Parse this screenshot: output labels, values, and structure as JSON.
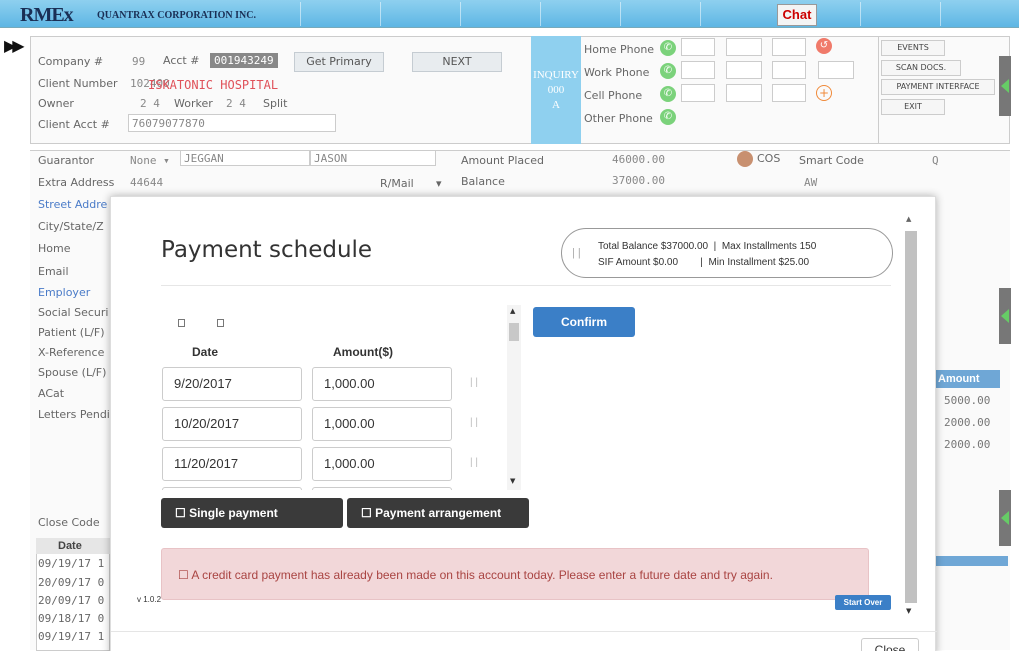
{
  "header": {
    "logo": "RMEx",
    "corporation": "QUANTRAX CORPORATION INC.",
    "chat_label": "Chat"
  },
  "account": {
    "company_label": "Company #",
    "company_value": "99",
    "acct_label": "Acct #",
    "acct_value": "001943249",
    "get_primary_label": "Get Primary",
    "next_label": "NEXT",
    "client_number_label": "Client Number",
    "client_number_value": "102400",
    "client_name": "ISKATONIC HOSPITAL",
    "owner_label": "Owner",
    "owner_value": "2 4",
    "worker_label": "Worker",
    "worker_value": "2 4",
    "split_label": "Split",
    "client_acct_label": "Client Acct #",
    "client_acct_value": "76079077870",
    "inquiry_lines": [
      "INQUIRY",
      "000",
      "A"
    ],
    "phones": [
      "Home Phone",
      "Work Phone",
      "Cell Phone",
      "Other Phone"
    ],
    "side_buttons": [
      "EVENTS",
      "SCAN DOCS.",
      "PAYMENT INTERFACE",
      "EXIT"
    ]
  },
  "form": {
    "guarantor_label": "Guarantor",
    "guarantor_select": "None",
    "guarantor_last": "JEGGAN",
    "guarantor_first": "JASON",
    "amount_placed_label": "Amount Placed",
    "amount_placed_value": "46000.00",
    "cos_label": "COS",
    "smart_code_label": "Smart Code",
    "smart_code_value": "Q",
    "extra_address_label": "Extra Address",
    "extra_address_value": "44644",
    "rmail_label": "R/Mail",
    "balance_label": "Balance",
    "balance_value": "37000.00",
    "aw_value": "AW",
    "street_label": "Street Addre",
    "city_label": "City/State/Z",
    "home_label": "Home",
    "email_label": "Email",
    "employer_label": "Employer",
    "social_label": "Social Securi",
    "patient_label": "Patient (L/F)",
    "xref_label": "X-Reference",
    "spouse_label": "Spouse (L/F)",
    "acat_label": "ACat",
    "letters_label": "Letters Pendi",
    "close_code_label": "Close Code",
    "date_header": "Date",
    "history_dates": [
      "09/19/17",
      "20/09/17",
      "20/09/17",
      "09/18/17",
      "09/19/17"
    ],
    "history_suffix": [
      "1",
      "0",
      "0",
      "0",
      "1"
    ],
    "right_amount_header": "Amount",
    "right_amounts": [
      "5000.00",
      "2000.00",
      "2000.00"
    ]
  },
  "modal": {
    "title": "Payment schedule",
    "total_balance": "Total Balance $37000.00",
    "max_installments": "Max Installments 150",
    "sif_amount": "SIF Amount  $0.00",
    "min_installment": "Min Installment  $25.00",
    "date_header": "Date",
    "amount_header": "Amount($)",
    "rows": [
      {
        "date": "9/20/2017",
        "amount": "1,000.00"
      },
      {
        "date": "10/20/2017",
        "amount": "1,000.00"
      },
      {
        "date": "11/20/2017",
        "amount": "1,000.00"
      }
    ],
    "confirm_label": "Confirm",
    "single_payment_label": "☐ Single payment",
    "payment_arrangement_label": "☐ Payment arrangement",
    "alert_text": "☐ A credit card payment has already been made on this account today. Please enter a future date and try again.",
    "version": "v 1.0.2",
    "start_over_label": "Start Over",
    "close_label": "Close"
  }
}
